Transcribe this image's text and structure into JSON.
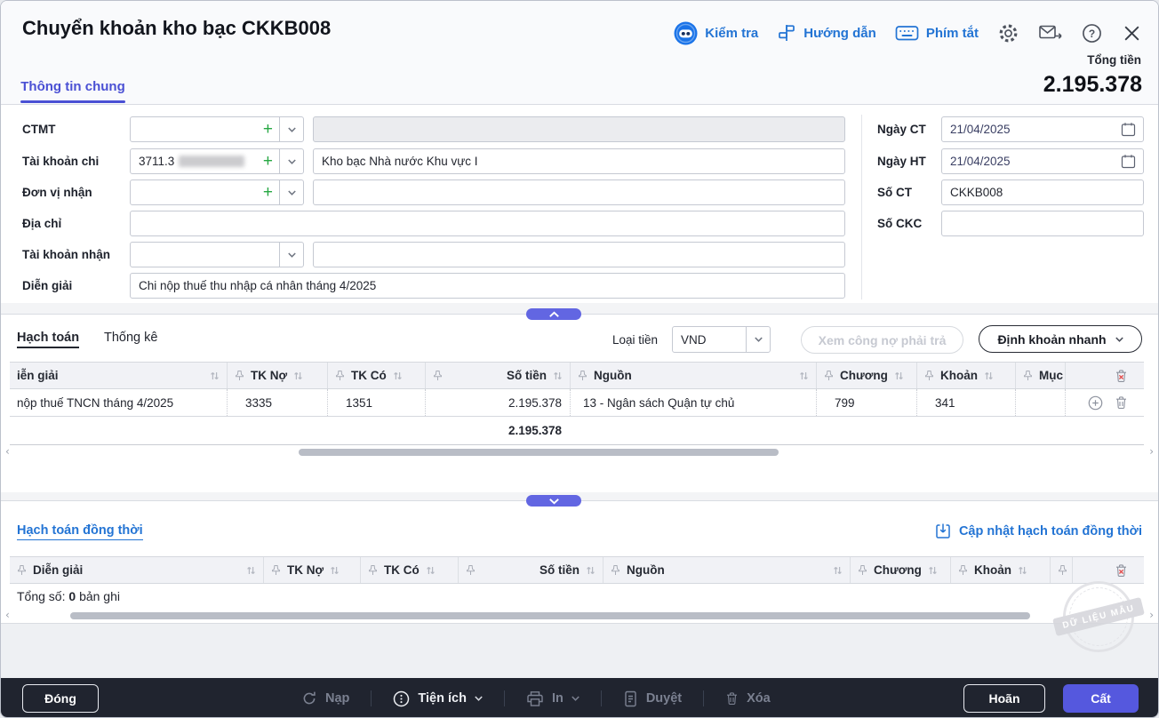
{
  "colors": {
    "accent_purple": "#5b5fe0",
    "link_blue": "#2374d4",
    "footer_bg": "#20242f",
    "plus_green": "#27a844",
    "table_header_bg": "#f1f2f6"
  },
  "header": {
    "title": "Chuyển khoản kho bạc CKKB008",
    "link_kiem_tra": "Kiểm tra",
    "link_huong_dan": "Hướng dẫn",
    "link_phim_tat": "Phím tắt",
    "total_label": "Tổng tiền",
    "total_value": "2.195.378",
    "tab": "Thông tin chung"
  },
  "form": {
    "ctmt": {
      "label": "CTMT"
    },
    "tai_khoan_chi": {
      "label": "Tài khoản chi",
      "value": "3711.3",
      "name": "Kho bạc Nhà nước Khu vực I"
    },
    "don_vi_nhan": {
      "label": "Đơn vị nhận"
    },
    "dia_chi": {
      "label": "Địa chỉ"
    },
    "tai_khoan_nhan": {
      "label": "Tài khoản nhận"
    },
    "dien_giai": {
      "label": "Diễn giải",
      "value": "Chi nộp thuế thu nhập cá nhân tháng 4/2025"
    },
    "ngay_ct": {
      "label": "Ngày CT",
      "value": "21/04/2025"
    },
    "ngay_ht": {
      "label": "Ngày HT",
      "value": "21/04/2025"
    },
    "so_ct": {
      "label": "Số CT",
      "value": "CKKB008"
    },
    "so_ckc": {
      "label": "Số CKC",
      "value": ""
    }
  },
  "accounting": {
    "tab_hach_toan": "Hạch toán",
    "tab_thong_ke": "Thống kê",
    "loai_tien_label": "Loại tiền",
    "currency": "VND",
    "btn_xem_cong_no": "Xem công nợ phải trả",
    "btn_dinh_khoan_nhanh": "Định khoản nhanh",
    "table": {
      "headers": [
        "iễn giải",
        "TK Nợ",
        "TK Có",
        "Số tiền",
        "Nguồn",
        "Chương",
        "Khoản",
        "Mục"
      ],
      "row": [
        "nộp thuế TNCN tháng 4/2025",
        "3335",
        "1351",
        "2.195.378",
        "13 - Ngân sách Quận tự chủ",
        "799",
        "341",
        ""
      ],
      "total": "2.195.378"
    }
  },
  "simultaneous": {
    "title": "Hạch toán đồng thời",
    "update_link": "Cập nhật hạch toán đồng thời",
    "headers": [
      "Diễn giải",
      "TK Nợ",
      "TK Có",
      "Số tiền",
      "Nguồn",
      "Chương",
      "Khoản"
    ],
    "total_label": "Tổng số:",
    "total_count": "0",
    "total_suffix": "bản ghi"
  },
  "watermark": {
    "text": "DỮ LIỆU MẪU"
  },
  "footer": {
    "dong": "Đóng",
    "nap": "Nạp",
    "tien_ich": "Tiện ích",
    "in": "In",
    "duyet": "Duyệt",
    "xoa": "Xóa",
    "hoan": "Hoãn",
    "cat": "Cất"
  }
}
